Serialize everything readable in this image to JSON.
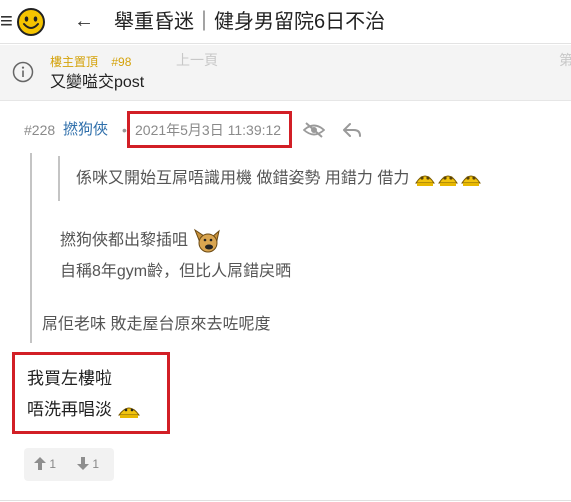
{
  "header": {
    "menu_icon": "≡",
    "back_icon": "←",
    "title": "舉重昏迷｜健身男留院6日不治"
  },
  "pinned": {
    "label": "樓主置頂",
    "number": "#98",
    "text": "又變嗌交post",
    "prev_page": "上一頁",
    "next_page": "第"
  },
  "post": {
    "number": "#228",
    "author": "撚狗俠",
    "separator": "•",
    "timestamp": "2021年5月3日 11:39:12",
    "quote_nested": {
      "text": "係咪又開始互屌唔識用機 做錯姿勢 用錯力 借力"
    },
    "quote": {
      "line1": "撚狗俠都出黎插咀",
      "line2": "自稱8年gym齡，但比人屌錯戻晒",
      "line3": "屌佢老味 敗走屋台原來去咗呢度"
    },
    "reply": {
      "line1": "我買左樓啦",
      "line2": "唔洗再唱淡"
    },
    "votes": {
      "up": "1",
      "down": "1"
    }
  },
  "colors": {
    "highlight_box": "#d21f26",
    "pinned_meta": "#d4a20a",
    "author_link": "#2f6fab"
  }
}
